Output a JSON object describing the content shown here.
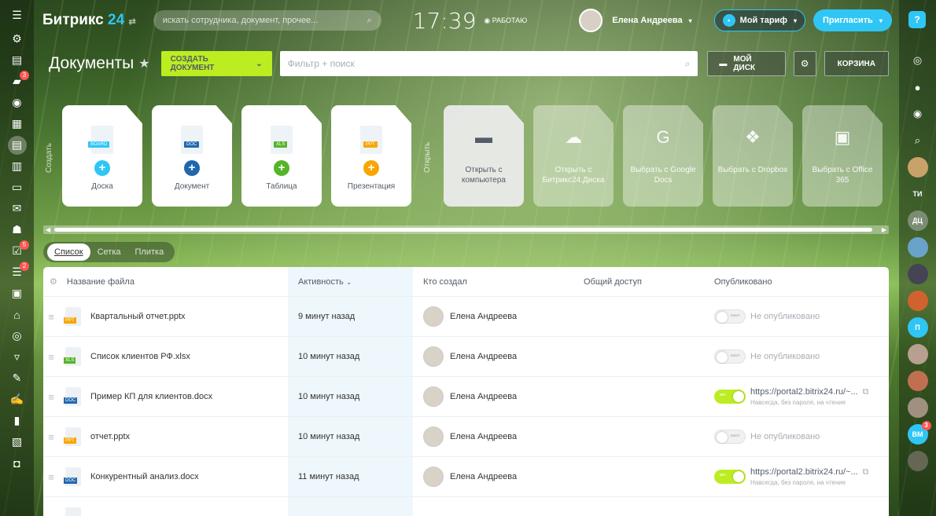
{
  "header": {
    "logo_main": "Битрикс",
    "logo_num": "24",
    "search_placeholder": "искать сотрудника, документ, прочее...",
    "clock": "17:39",
    "work_status": "РАБОТАЮ",
    "user_name": "Елена Андреева",
    "tariff_label": "Мой тариф",
    "invite_label": "Пригласить",
    "help_label": "?"
  },
  "left_nav": {
    "badges": {
      "chat": "3",
      "tasks": "5",
      "feed": "2"
    }
  },
  "right_panel": {
    "avatars": [
      "ТИ",
      "ДЦ",
      "П",
      "ВМ"
    ],
    "badge_vm": "3"
  },
  "toolbar": {
    "title": "Документы",
    "create_label": "СОЗДАТЬ ДОКУМЕНТ",
    "filter_placeholder": "Фильтр + поиск",
    "disk_label": "МОЙ ДИСК",
    "trash_label": "КОРЗИНА"
  },
  "create_section": {
    "label": "Создать",
    "tiles": [
      {
        "tag": "BOARD",
        "label": "Доска",
        "color": "#2fc6f6"
      },
      {
        "tag": "DOC",
        "label": "Документ",
        "color": "#2067b0"
      },
      {
        "tag": "XLS",
        "label": "Таблица",
        "color": "#55b42a"
      },
      {
        "tag": "PPT",
        "label": "Презентация",
        "color": "#f7a700"
      }
    ]
  },
  "open_section": {
    "label": "Открыть",
    "tiles": [
      {
        "label": "Открыть с компьютера"
      },
      {
        "label": "Открыть с Битрикс24.Диска"
      },
      {
        "label": "Выбрать с Google Docs"
      },
      {
        "label": "Выбрать с Dropbox"
      },
      {
        "label": "Выбрать с Office 365"
      }
    ]
  },
  "views": {
    "list": "Список",
    "grid": "Сетка",
    "tiles": "Плитка"
  },
  "grid": {
    "columns": {
      "name": "Название файла",
      "activity": "Активность",
      "creator": "Кто создал",
      "shared": "Общий доступ",
      "published": "Опубликовано"
    },
    "rows": [
      {
        "tag": "PPT",
        "tag_color": "#f7a700",
        "name": "Квартальный отчет.pptx",
        "activity": "9 минут назад",
        "creator": "Елена Андреева",
        "published": false,
        "pub_text": "Не опубликовано",
        "toggle_text": "выкл"
      },
      {
        "tag": "XLS",
        "tag_color": "#55b42a",
        "name": "Список клиентов РФ.xlsx",
        "activity": "10 минут назад",
        "creator": "Елена Андреева",
        "published": false,
        "pub_text": "Не опубликовано",
        "toggle_text": "выкл"
      },
      {
        "tag": "DOC",
        "tag_color": "#2067b0",
        "name": "Пример КП для клиентов.docx",
        "activity": "10 минут назад",
        "creator": "Елена Андреева",
        "published": true,
        "pub_text": "https://portal2.bitrix24.ru/~...",
        "pub_sub": "Навсегда, без пароля, на чтение",
        "toggle_text": "вкл"
      },
      {
        "tag": "PPT",
        "tag_color": "#f7a700",
        "name": "отчет.pptx",
        "activity": "10 минут назад",
        "creator": "Елена Андреева",
        "published": false,
        "pub_text": "Не опубликовано",
        "toggle_text": "выкл"
      },
      {
        "tag": "DOC",
        "tag_color": "#2067b0",
        "name": "Конкурентный анализ.docx",
        "activity": "11 минут назад",
        "creator": "Елена Андреева",
        "published": true,
        "pub_text": "https://portal2.bitrix24.ru/~...",
        "pub_sub": "Навсегда, без пароля, на чтение",
        "toggle_text": "вкл"
      }
    ]
  }
}
